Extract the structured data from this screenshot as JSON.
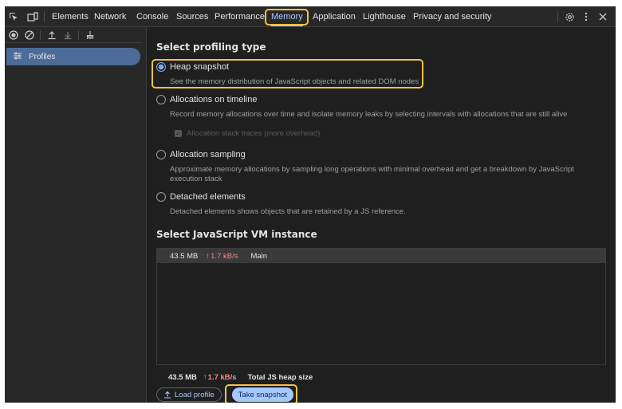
{
  "tabs": [
    "Elements",
    "Network",
    "Console",
    "Sources",
    "Performance",
    "Memory",
    "Application",
    "Lighthouse",
    "Privacy and security"
  ],
  "selected_tab": "Memory",
  "sidebar": {
    "item_label": "Profiles"
  },
  "profiling": {
    "title": "Select profiling type",
    "options": [
      {
        "label": "Heap snapshot",
        "description": "See the memory distribution of JavaScript objects and related DOM nodes",
        "checked": true
      },
      {
        "label": "Allocations on timeline",
        "description": "Record memory allocations over time and isolate memory leaks by selecting intervals with allocations that are still alive",
        "checked": false
      },
      {
        "label": "Allocation sampling",
        "description": "Approximate memory allocations by sampling long operations with minimal overhead and get a breakdown by JavaScript execution stack",
        "checked": false
      },
      {
        "label": "Detached elements",
        "description": "Detached elements shows objects that are retained by a JS reference.",
        "checked": false
      }
    ],
    "stack_traces_label": "Allocation stack traces (more overhead)"
  },
  "vm": {
    "title": "Select JavaScript VM instance",
    "row": {
      "size": "43.5 MB",
      "arrow": "↑",
      "rate": "1.7 kB/s",
      "name": "Main"
    }
  },
  "footer": {
    "size": "43.5 MB",
    "arrow": "↑",
    "rate": "1.7 kB/s",
    "total_label": "Total JS heap size",
    "load_button": "Load profile",
    "load_icon": "upload-icon",
    "snapshot_button": "Take snapshot"
  },
  "colors": {
    "accent": "#a8c7fa",
    "highlight": "#f5c242",
    "panel_bg": "#1f1f1f",
    "toolbar_bg": "#282828"
  }
}
